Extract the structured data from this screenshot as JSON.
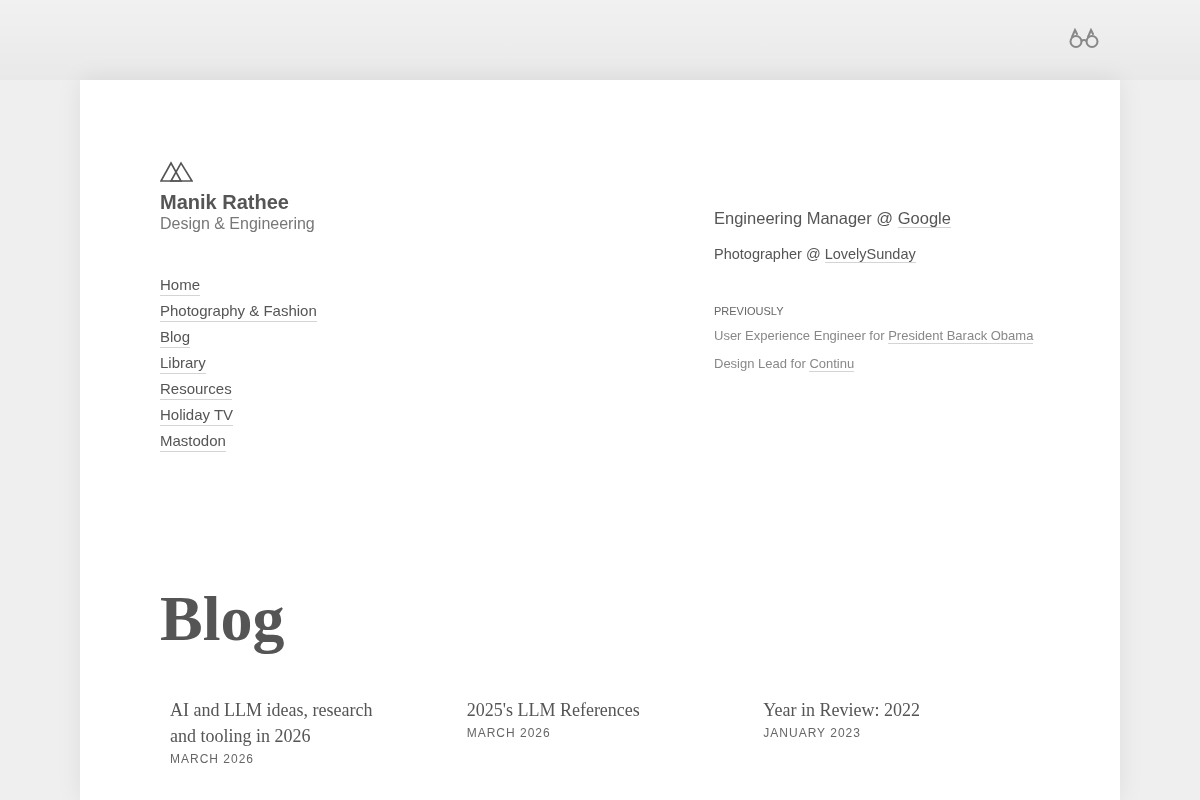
{
  "header": {
    "name": "Manik Rathee",
    "tagline": "Design & Engineering"
  },
  "nav": [
    "Home",
    "Photography & Fashion",
    "Blog",
    "Library",
    "Resources",
    "Holiday TV",
    "Mastodon"
  ],
  "roles": {
    "current": [
      {
        "kind": "primary",
        "prefix": "Engineering Manager @",
        "link": "Google"
      },
      {
        "kind": "secondary",
        "prefix": "Photographer @",
        "link": "LovelySunday"
      }
    ],
    "previously_label": "PREVIOUSLY",
    "previous": [
      {
        "prefix": "User Experience Engineer for",
        "link": "President Barack Obama"
      },
      {
        "prefix": "Design Lead for",
        "link": "Continu"
      }
    ]
  },
  "blog": {
    "heading": "Blog",
    "posts": [
      {
        "title": "AI and LLM ideas, research and tooling in 2026",
        "date": "MARCH 2026"
      },
      {
        "title": "2025's LLM References",
        "date": "MARCH 2026"
      },
      {
        "title": "Year in Review: 2022",
        "date": "JANUARY 2023"
      }
    ]
  }
}
